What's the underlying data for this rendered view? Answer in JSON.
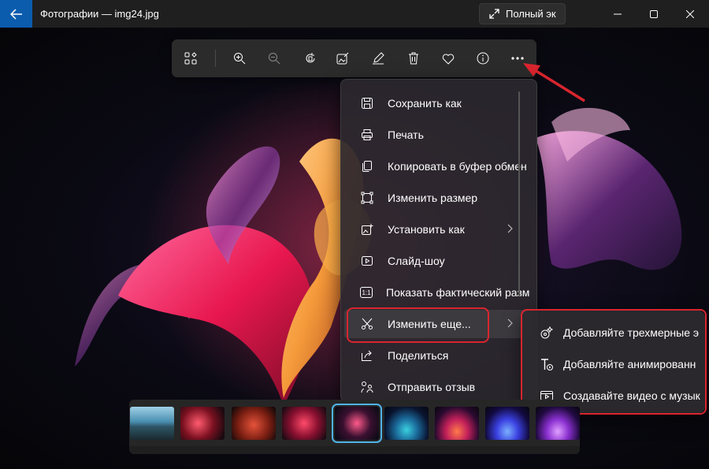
{
  "window": {
    "title": "Фотографии — img24.jpg",
    "fullscreen_label": "Полный эк"
  },
  "toolbar": {
    "buttons": [
      "gallery-icon",
      "zoom-in-icon",
      "zoom-out-icon",
      "rotate-icon",
      "edit-image-icon",
      "draw-icon",
      "delete-icon",
      "favorite-icon",
      "info-icon",
      "more-icon"
    ]
  },
  "menu": {
    "items": [
      {
        "label": "Сохранить как",
        "icon": "save-icon"
      },
      {
        "label": "Печать",
        "icon": "print-icon"
      },
      {
        "label": "Копировать в буфер обмен",
        "icon": "copy-icon"
      },
      {
        "label": "Изменить размер",
        "icon": "resize-icon"
      },
      {
        "label": "Установить как",
        "icon": "set-as-icon",
        "submenu": true
      },
      {
        "label": "Слайд-шоу",
        "icon": "slideshow-icon"
      },
      {
        "label": "Показать фактический разм",
        "icon": "actual-size-icon"
      },
      {
        "label": "Изменить еще...",
        "icon": "edit-more-icon",
        "submenu": true
      },
      {
        "label": "Поделиться",
        "icon": "share-icon"
      },
      {
        "label": "Отправить отзыв",
        "icon": "feedback-icon"
      }
    ],
    "actual_size_glyph": "1:1"
  },
  "submenu": {
    "items": [
      {
        "label": "Добавляйте трехмерные э",
        "icon": "3d-effects-icon"
      },
      {
        "label": "Добавляйте анимированн",
        "icon": "animated-text-icon"
      },
      {
        "label": "Создавайте видео с музык",
        "icon": "video-icon"
      }
    ]
  },
  "filmstrip": {
    "thumbnails": 9,
    "selected_index": 4
  },
  "colors": {
    "accent_back": "#0b5cad",
    "highlight_red": "#d9252e",
    "selected_thumb": "#4fb3e8"
  }
}
